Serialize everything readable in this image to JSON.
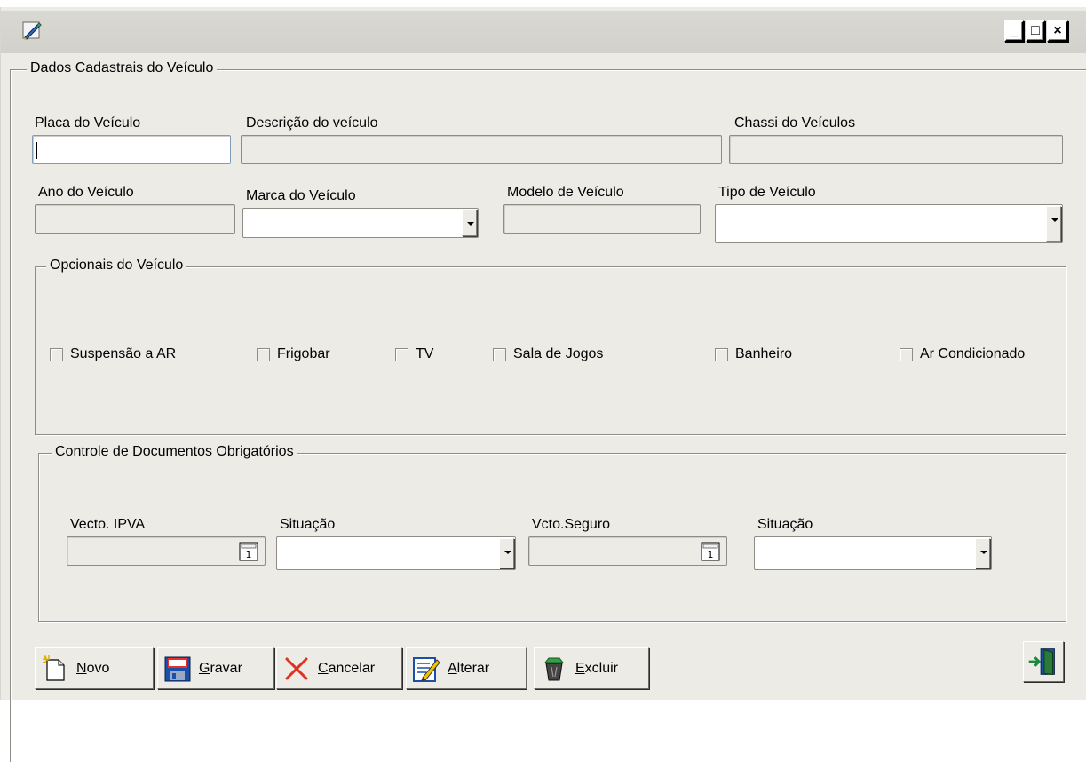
{
  "window": {
    "title_icon": "pencil-edit-icon",
    "controls": {
      "minimize": "_",
      "maximize": "□",
      "close": "×"
    }
  },
  "dados": {
    "legend": "Dados Cadastrais do Veículo",
    "placa_label": "Placa do Veículo",
    "placa_value": "",
    "descricao_label": "Descrição do veículo",
    "chassi_label": "Chassi do Veículos",
    "ano_label": "Ano do Veículo",
    "marca_label": "Marca do Veículo",
    "modelo_label": "Modelo de Veículo",
    "tipo_label": "Tipo de Veículo"
  },
  "opcionais": {
    "legend": "Opcionais do Veículo",
    "items": [
      {
        "label": "Suspensão a AR",
        "checked": false
      },
      {
        "label": "Frigobar",
        "checked": false
      },
      {
        "label": "TV",
        "checked": false
      },
      {
        "label": "Sala de Jogos",
        "checked": false
      },
      {
        "label": "Banheiro",
        "checked": false
      },
      {
        "label": "Ar Condicionado",
        "checked": false
      }
    ]
  },
  "documentos": {
    "legend": "Controle de Documentos Obrigatórios",
    "ipva_label": "Vecto. IPVA",
    "situacao1_label": "Situação",
    "seguro_label": "Vcto.Seguro",
    "situacao2_label": "Situação"
  },
  "toolbar": {
    "novo": {
      "hotkey": "N",
      "rest": "ovo",
      "icon": "new-document-icon"
    },
    "gravar": {
      "hotkey": "G",
      "rest": "ravar",
      "icon": "floppy-disk-icon"
    },
    "cancelar": {
      "hotkey": "C",
      "rest": "ancelar",
      "icon": "cancel-x-icon"
    },
    "alterar": {
      "hotkey": "A",
      "rest": "lterar",
      "icon": "edit-pencil-icon"
    },
    "excluir": {
      "hotkey": "E",
      "rest": "xcluir",
      "icon": "recycle-bin-icon"
    },
    "exit_icon": "exit-door-icon"
  }
}
